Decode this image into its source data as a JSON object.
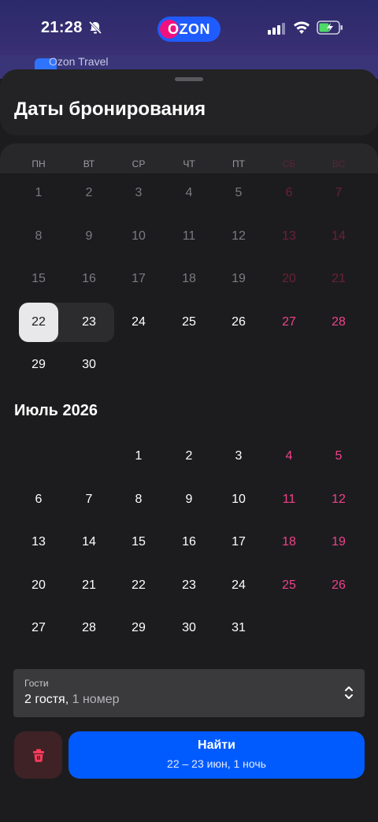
{
  "status_bar": {
    "time": "21:28"
  },
  "app_badge": {
    "text": "OZON"
  },
  "background_app": {
    "title": "Ozon Travel"
  },
  "sheet": {
    "title": "Даты бронирования"
  },
  "weekdays": [
    "ПН",
    "ВТ",
    "СР",
    "ЧТ",
    "ПТ",
    "СБ",
    "ВС"
  ],
  "june": {
    "rows": [
      [
        "1",
        "2",
        "3",
        "4",
        "5",
        "6",
        "7"
      ],
      [
        "8",
        "9",
        "10",
        "11",
        "12",
        "13",
        "14"
      ],
      [
        "15",
        "16",
        "17",
        "18",
        "19",
        "20",
        "21"
      ],
      [
        "22",
        "23",
        "24",
        "25",
        "26",
        "27",
        "28"
      ],
      [
        "29",
        "30",
        "",
        "",
        "",
        "",
        ""
      ]
    ],
    "selected_start": "22",
    "selected_end": "23"
  },
  "july": {
    "title": "Июль 2026",
    "rows": [
      [
        "",
        "",
        "1",
        "2",
        "3",
        "4",
        "5"
      ],
      [
        "6",
        "7",
        "8",
        "9",
        "10",
        "11",
        "12"
      ],
      [
        "13",
        "14",
        "15",
        "16",
        "17",
        "18",
        "19"
      ],
      [
        "20",
        "21",
        "22",
        "23",
        "24",
        "25",
        "26"
      ],
      [
        "27",
        "28",
        "29",
        "30",
        "31",
        "",
        ""
      ]
    ]
  },
  "guests": {
    "label": "Гости",
    "value": "2 гостя,",
    "rooms": " 1 номер"
  },
  "find_button": {
    "label": "Найти",
    "sub": "22 – 23 июн, 1 ночь"
  },
  "colors": {
    "accent": "#005bff",
    "weekend": "#f0418c",
    "selected": "#e8e8ea"
  }
}
